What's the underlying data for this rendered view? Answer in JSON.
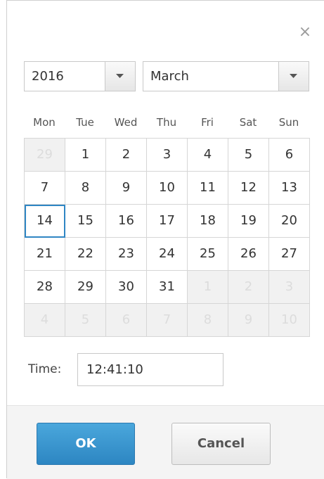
{
  "dialog": {
    "close_glyph": "×"
  },
  "year_select": {
    "value": "2016"
  },
  "month_select": {
    "value": "March"
  },
  "weekdays": [
    "Mon",
    "Tue",
    "Wed",
    "Thu",
    "Fri",
    "Sat",
    "Sun"
  ],
  "calendar": {
    "selected_day": "14",
    "weeks": [
      [
        {
          "d": "29",
          "o": true
        },
        {
          "d": "1"
        },
        {
          "d": "2"
        },
        {
          "d": "3"
        },
        {
          "d": "4"
        },
        {
          "d": "5"
        },
        {
          "d": "6"
        }
      ],
      [
        {
          "d": "7"
        },
        {
          "d": "8"
        },
        {
          "d": "9"
        },
        {
          "d": "10"
        },
        {
          "d": "11"
        },
        {
          "d": "12"
        },
        {
          "d": "13"
        }
      ],
      [
        {
          "d": "14",
          "s": true
        },
        {
          "d": "15"
        },
        {
          "d": "16"
        },
        {
          "d": "17"
        },
        {
          "d": "18"
        },
        {
          "d": "19"
        },
        {
          "d": "20"
        }
      ],
      [
        {
          "d": "21"
        },
        {
          "d": "22"
        },
        {
          "d": "23"
        },
        {
          "d": "24"
        },
        {
          "d": "25"
        },
        {
          "d": "26"
        },
        {
          "d": "27"
        }
      ],
      [
        {
          "d": "28"
        },
        {
          "d": "29"
        },
        {
          "d": "30"
        },
        {
          "d": "31"
        },
        {
          "d": "1",
          "o": true
        },
        {
          "d": "2",
          "o": true
        },
        {
          "d": "3",
          "o": true
        }
      ],
      [
        {
          "d": "4",
          "o": true
        },
        {
          "d": "5",
          "o": true
        },
        {
          "d": "6",
          "o": true
        },
        {
          "d": "7",
          "o": true
        },
        {
          "d": "8",
          "o": true
        },
        {
          "d": "9",
          "o": true
        },
        {
          "d": "10",
          "o": true
        }
      ]
    ]
  },
  "time": {
    "label": "Time:",
    "value": "12:41:10"
  },
  "footer": {
    "ok_label": "OK",
    "cancel_label": "Cancel"
  },
  "colors": {
    "accent": "#2d86c2",
    "selected_outline": "#2f86c4"
  }
}
